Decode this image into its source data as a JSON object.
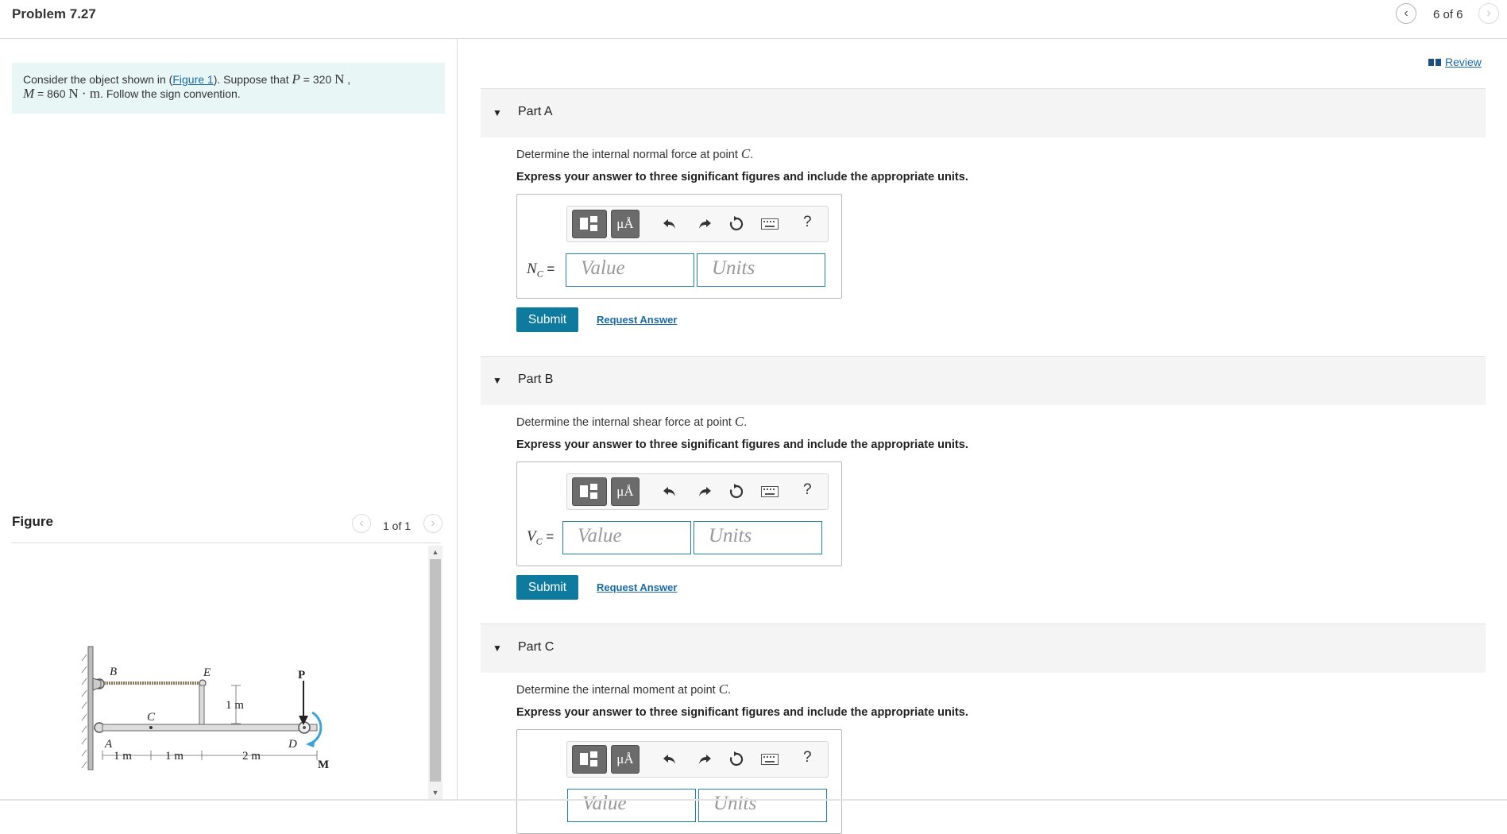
{
  "header": {
    "title": "Problem 7.27",
    "page_count": "6 of 6"
  },
  "problem": {
    "text_1": "Consider the object shown in (",
    "figure_link": "Figure 1",
    "text_2": "). Suppose that ",
    "p_var": "P",
    "p_eq": " = 320 ",
    "p_unit": "N",
    "comma": " ,",
    "m_var": "M",
    "m_eq": " = 860 ",
    "m_unit": "N · m",
    "text_3": ". Follow the sign convention."
  },
  "figure": {
    "label": "Figure",
    "count": "1 of 1",
    "labels": {
      "B": "B",
      "E": "E",
      "P": "P",
      "C": "C",
      "A": "A",
      "D": "D",
      "M": "M",
      "dim_1m_a": "1 m",
      "dim_1m_b": "1 m",
      "dim_2m": "2 m",
      "dim_1m_v": "1 m"
    }
  },
  "review_label": "Review",
  "parts": [
    {
      "title": "Part A",
      "question": "Determine the internal normal force at point ",
      "point": "C",
      "period": ".",
      "instruction": "Express your answer to three significant figures and include the appropriate units.",
      "var": "N",
      "var_sub": "C",
      "eq": " =",
      "value_placeholder": "Value",
      "units_placeholder": "Units",
      "submit": "Submit",
      "request": "Request Answer"
    },
    {
      "title": "Part B",
      "question": "Determine the internal shear force at point ",
      "point": "C",
      "period": ".",
      "instruction": "Express your answer to three significant figures and include the appropriate units.",
      "var": "V",
      "var_sub": "C",
      "eq": " =",
      "value_placeholder": "Value",
      "units_placeholder": "Units",
      "submit": "Submit",
      "request": "Request Answer"
    },
    {
      "title": "Part C",
      "question": "Determine the internal moment at point ",
      "point": "C",
      "period": ".",
      "instruction": "Express your answer to three significant figures and include the appropriate units.",
      "value_placeholder": "Value",
      "units_placeholder": "Units"
    }
  ],
  "toolbar": {
    "mu_label": "μÅ",
    "help_label": "?"
  },
  "colors": {
    "accent": "#0e7a9e",
    "link": "#1a6aa8",
    "problem_bg": "#e9f6f6",
    "part_header_bg": "#f4f4f4"
  }
}
